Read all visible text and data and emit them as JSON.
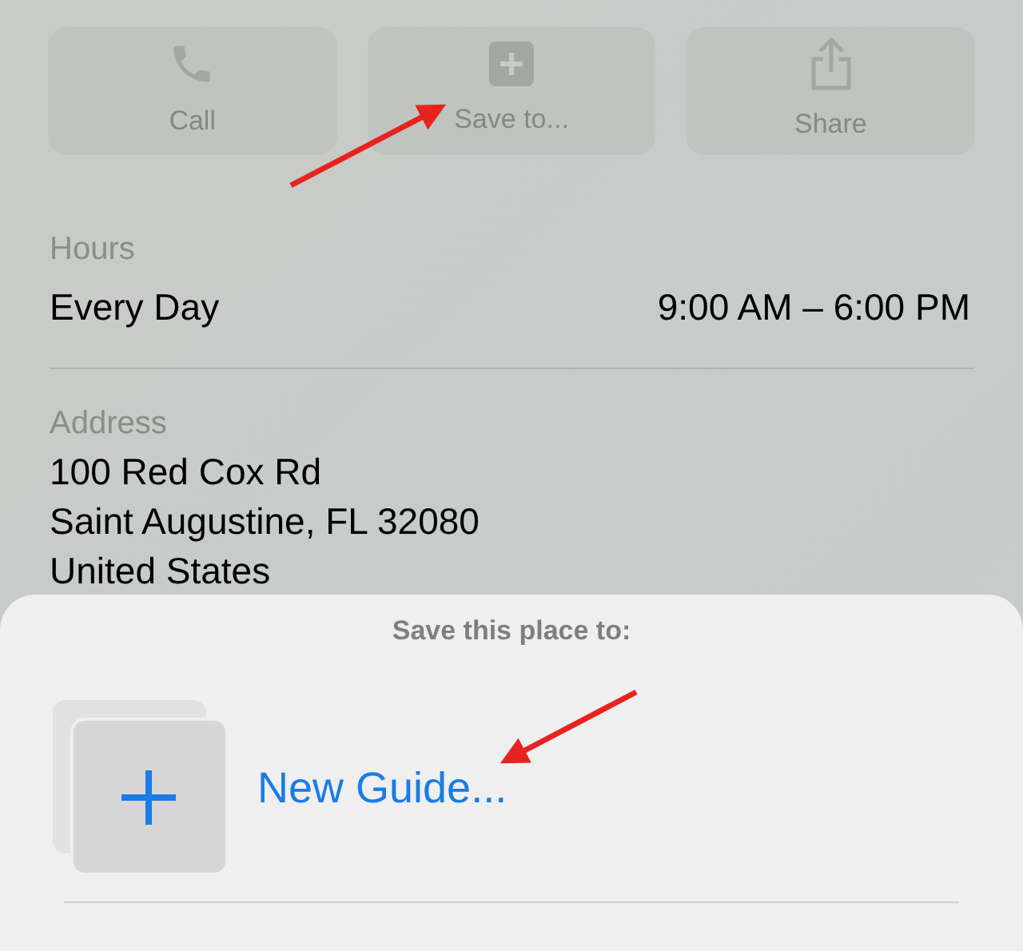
{
  "actions": [
    {
      "kind": "call",
      "label": "Call"
    },
    {
      "kind": "save",
      "label": "Save to..."
    },
    {
      "kind": "share",
      "label": "Share"
    }
  ],
  "hours": {
    "label": "Hours",
    "days": "Every Day",
    "time": "9:00 AM – 6:00 PM"
  },
  "address": {
    "label": "Address",
    "lines": [
      "100 Red Cox Rd",
      "Saint Augustine, FL 32080",
      "United States"
    ]
  },
  "sheet": {
    "title": "Save this place to:",
    "items": [
      {
        "label": "New Guide..."
      }
    ]
  }
}
